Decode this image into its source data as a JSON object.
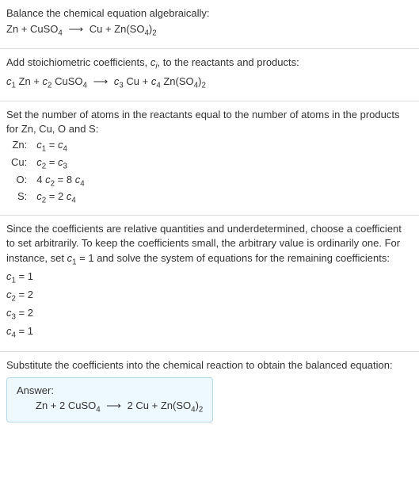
{
  "s1": {
    "title": "Balance the chemical equation algebraically:",
    "eq_pre": "Zn + CuSO",
    "eq_sub1": "4",
    "eq_arrow": "⟶",
    "eq_post1": "Cu + Zn(SO",
    "eq_sub2": "4",
    "eq_post2": ")",
    "eq_sub3": "2"
  },
  "s2": {
    "title_a": "Add stoichiometric coefficients, ",
    "title_ci": "c",
    "title_i": "i",
    "title_b": ", to the reactants and products:",
    "c1": "c",
    "n1": "1",
    "t1": " Zn + ",
    "c2": "c",
    "n2": "2",
    "t2": " CuSO",
    "sub2": "4",
    "arrow": "⟶",
    "c3": "c",
    "n3": "3",
    "t3": " Cu + ",
    "c4": "c",
    "n4": "4",
    "t4": " Zn(SO",
    "sub4a": "4",
    "t4b": ")",
    "sub4b": "2"
  },
  "s3": {
    "title": "Set the number of atoms in the reactants equal to the number of atoms in the products for Zn, Cu, O and S:",
    "rows": [
      {
        "label": "Zn:",
        "lhs_c": "c",
        "lhs_n": "1",
        "mid": " = ",
        "rhs_c": "c",
        "rhs_n": "4",
        "pre": "",
        "post": ""
      },
      {
        "label": "Cu:",
        "lhs_c": "c",
        "lhs_n": "2",
        "mid": " = ",
        "rhs_c": "c",
        "rhs_n": "3",
        "pre": "",
        "post": ""
      },
      {
        "label": "O:",
        "lhs_c": "c",
        "lhs_n": "2",
        "mid": " = 8 ",
        "rhs_c": "c",
        "rhs_n": "4",
        "pre": "4 ",
        "post": ""
      },
      {
        "label": "S:",
        "lhs_c": "c",
        "lhs_n": "2",
        "mid": " = 2 ",
        "rhs_c": "c",
        "rhs_n": "4",
        "pre": "",
        "post": ""
      }
    ]
  },
  "s4": {
    "p1a": "Since the coefficients are relative quantities and underdetermined, choose a coefficient to set arbitrarily. To keep the coefficients small, the arbitrary value is ordinarily one. For instance, set ",
    "c": "c",
    "n": "1",
    "p1b": " = 1 and solve the system of equations for the remaining coefficients:",
    "rows": [
      {
        "c": "c",
        "n": "1",
        "rhs": " = 1"
      },
      {
        "c": "c",
        "n": "2",
        "rhs": " = 2"
      },
      {
        "c": "c",
        "n": "3",
        "rhs": " = 2"
      },
      {
        "c": "c",
        "n": "4",
        "rhs": " = 1"
      }
    ]
  },
  "s5": {
    "title": "Substitute the coefficients into the chemical reaction to obtain the balanced equation:",
    "answer_label": "Answer:",
    "eq_a": "Zn + 2 CuSO",
    "sub1": "4",
    "arrow": "⟶",
    "eq_b": "2 Cu + Zn(SO",
    "sub2": "4",
    "eq_c": ")",
    "sub3": "2"
  }
}
